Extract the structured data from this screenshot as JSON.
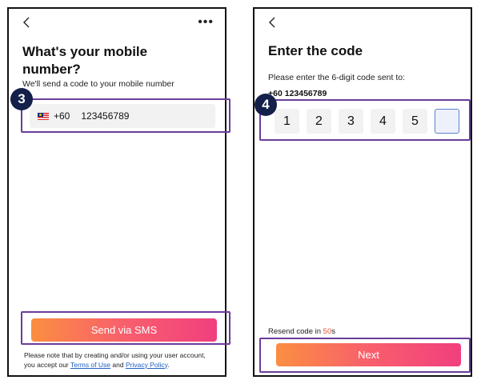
{
  "screens": {
    "phone_entry": {
      "title": "What's your mobile number?",
      "subtitle": "We'll send a code to your mobile number",
      "country_code": "+60",
      "phone_value": "123456789",
      "step_badge": "3",
      "send_button": "Send via SMS",
      "legal": {
        "prefix": "Please note that by creating and/or using your user account, you accept our ",
        "terms_link": "Terms of Use",
        "conjunction": " and ",
        "privacy_link": "Privacy Policy",
        "suffix": "."
      }
    },
    "code_entry": {
      "title": "Enter the code",
      "subtitle": "Please enter the 6-digit code sent to:",
      "phone_number": "+60 123456789",
      "step_badge": "4",
      "code_digits": [
        "1",
        "2",
        "3",
        "4",
        "5",
        ""
      ],
      "resend_prefix": "Resend code in ",
      "resend_seconds": "50",
      "resend_suffix": "s",
      "next_button": "Next"
    }
  },
  "colors": {
    "highlight_border": "#6a3d9a",
    "badge_bg": "#14204a",
    "button_gradient_start": "#fb8e41",
    "button_gradient_end": "#f13f7f",
    "link": "#1f5fbf",
    "timer": "#e8522e",
    "active_box_border": "#5b7fd6"
  },
  "icons": {
    "back": "chevron-left-icon",
    "more": "more-horizontal-icon",
    "flag": "malaysia-flag-icon"
  }
}
